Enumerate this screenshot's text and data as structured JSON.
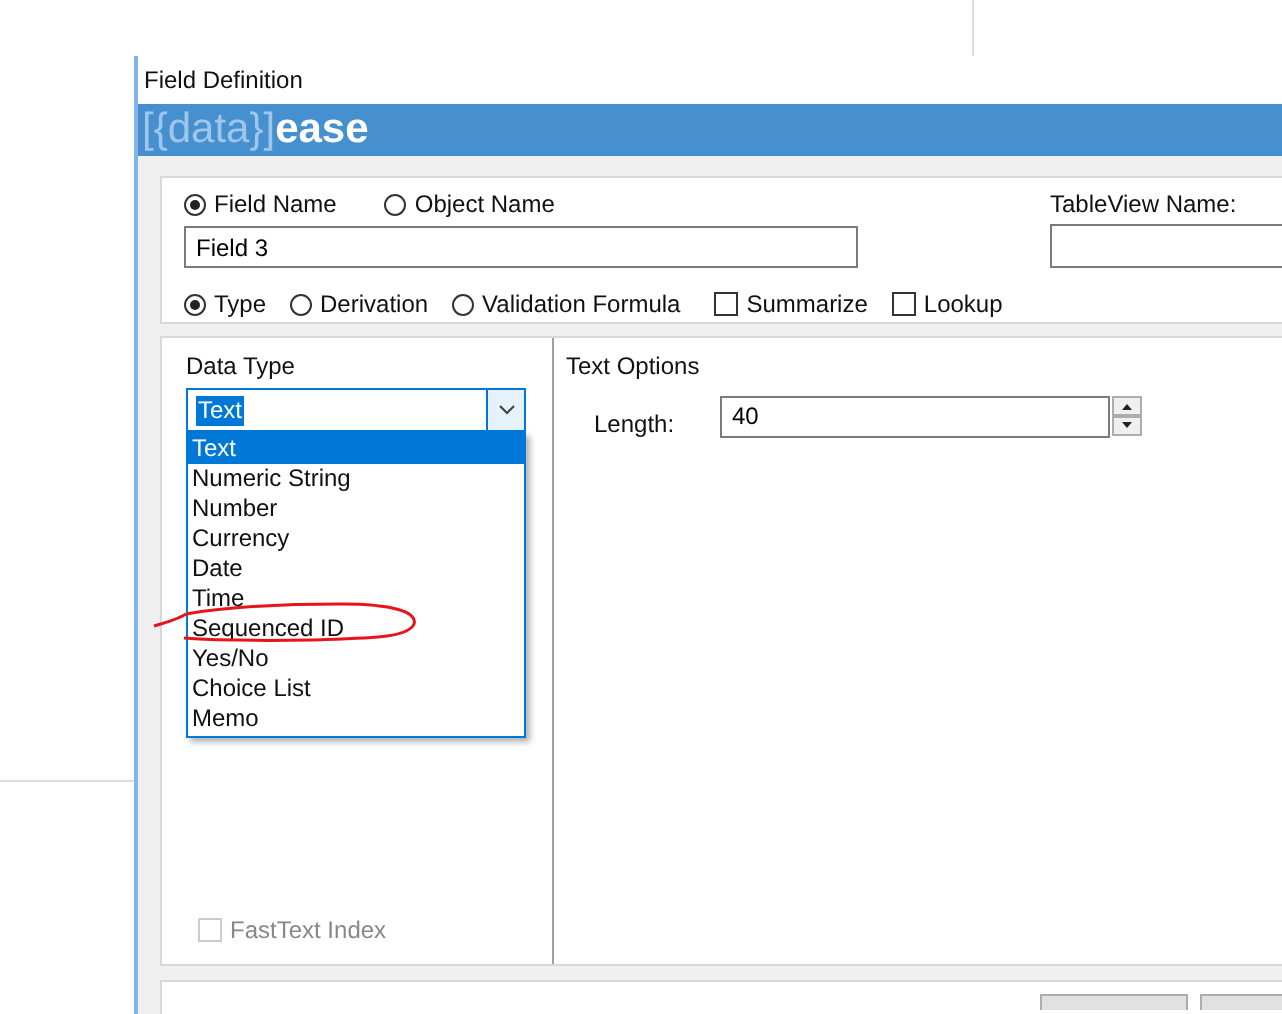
{
  "window": {
    "title": "Field Definition"
  },
  "banner": {
    "logo_light": "[{data}]",
    "logo_bold": "ease"
  },
  "name_mode": [
    {
      "label": "Field Name",
      "selected": true
    },
    {
      "label": "Object Name",
      "selected": false
    }
  ],
  "field_name": {
    "value": "Field 3"
  },
  "tableview": {
    "label": "TableView Name:"
  },
  "field_mode": [
    {
      "label": "Type",
      "selected": true
    },
    {
      "label": "Derivation",
      "selected": false
    },
    {
      "label": "Validation Formula",
      "selected": false
    }
  ],
  "flags": [
    {
      "label": "Summarize",
      "checked": false
    },
    {
      "label": "Lookup",
      "checked": false
    }
  ],
  "data_type": {
    "label": "Data Type",
    "value": "Text",
    "expanded": true,
    "options": [
      {
        "label": "Text",
        "selected": true
      },
      {
        "label": "Numeric String",
        "selected": false
      },
      {
        "label": "Number",
        "selected": false
      },
      {
        "label": "Currency",
        "selected": false
      },
      {
        "label": "Date",
        "selected": false
      },
      {
        "label": "Time",
        "selected": false
      },
      {
        "label": "Sequenced ID",
        "selected": false
      },
      {
        "label": "Yes/No",
        "selected": false
      },
      {
        "label": "Choice List",
        "selected": false
      },
      {
        "label": "Memo",
        "selected": false
      }
    ]
  },
  "fasttext": {
    "label": "FastText Index",
    "checked": false,
    "disabled": true
  },
  "text_options": {
    "title": "Text Options",
    "length_label": "Length:",
    "length": "40"
  },
  "annotation": {
    "kind": "ellipse"
  }
}
